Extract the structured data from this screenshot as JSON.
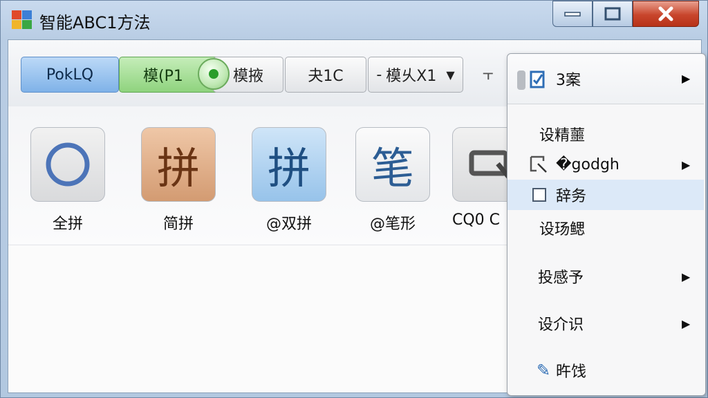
{
  "window": {
    "title": "智能ABC1方法"
  },
  "toolbar": {
    "buttons": [
      {
        "label": "PokLQ"
      },
      {
        "label": "模(P1"
      },
      {
        "label": "模掖"
      },
      {
        "label": "夬1C"
      },
      {
        "label": "模乆X1"
      }
    ]
  },
  "tiles": [
    {
      "glyph": "",
      "label": "全拼"
    },
    {
      "glyph": "拼",
      "label": "简拼"
    },
    {
      "glyph": "拼",
      "label": "@双拼"
    },
    {
      "glyph": "笔",
      "label": "@笔形"
    },
    {
      "glyph": "",
      "label": "CQ0 C"
    }
  ],
  "menu": {
    "header": {
      "label": "3案"
    },
    "items": [
      {
        "label": "设精蘁"
      },
      {
        "label": "�godgh"
      },
      {
        "label": "辞务"
      },
      {
        "label": "设玚鳃"
      },
      {
        "label": "投感予"
      },
      {
        "label": "设介识"
      },
      {
        "label": "旿饯"
      }
    ]
  }
}
